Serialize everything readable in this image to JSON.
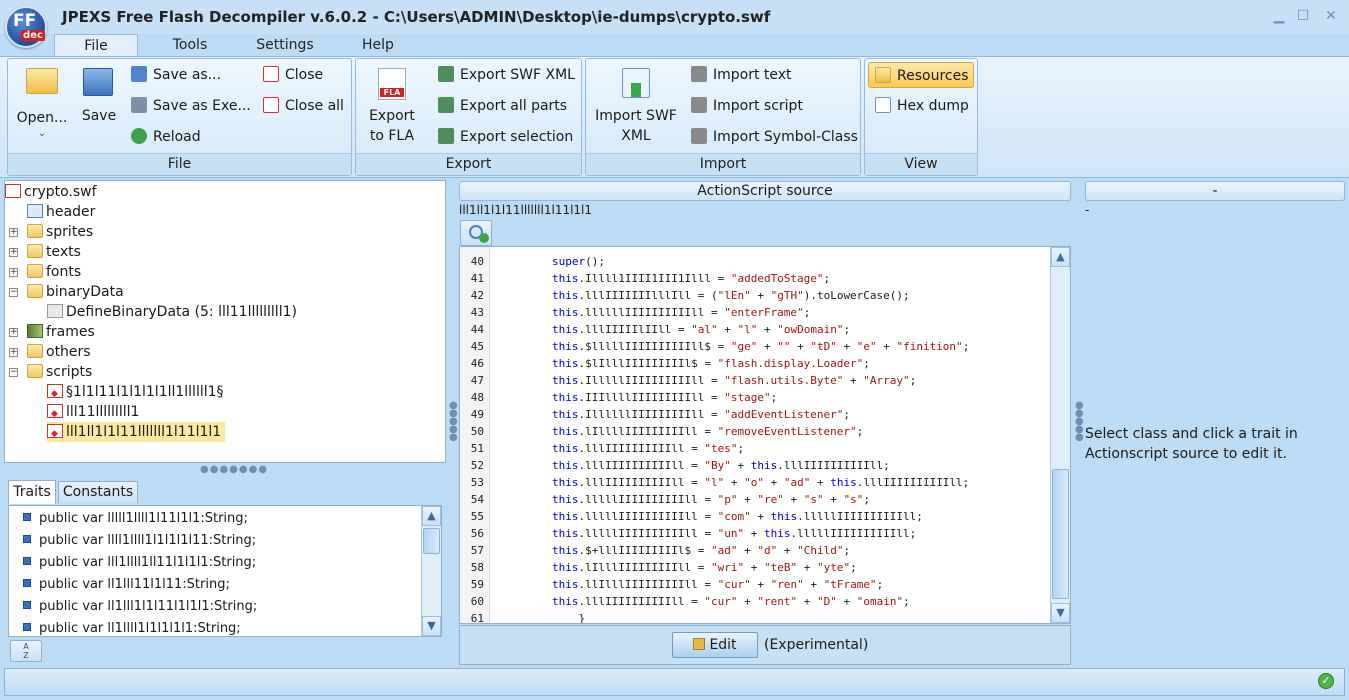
{
  "window": {
    "title": "JPEXS Free Flash Decompiler v.6.0.2 - C:\\Users\\ADMIN\\Desktop\\ie-dumps\\crypto.swf",
    "logo_text": "FF",
    "logo_sub": "dec"
  },
  "ribbon_tabs": [
    "File",
    "Tools",
    "Settings",
    "Help"
  ],
  "ribbon": {
    "file_group": {
      "label": "File",
      "open": "Open...",
      "save": "Save",
      "save_as": "Save as...",
      "save_as_exe": "Save as Exe...",
      "reload": "Reload",
      "close": "Close",
      "close_all": "Close all"
    },
    "export_group": {
      "label": "Export",
      "export_fla_1": "Export",
      "export_fla_2": "to FLA",
      "fla_badge": "FLA",
      "export_swf_xml": "Export SWF XML",
      "export_all_parts": "Export all parts",
      "export_selection": "Export selection"
    },
    "import_group": {
      "label": "Import",
      "import_swf_xml_1": "Import SWF",
      "import_swf_xml_2": "XML",
      "import_text": "Import text",
      "import_script": "Import script",
      "import_symbol_class": "Import Symbol-Class"
    },
    "view_group": {
      "label": "View",
      "resources": "Resources",
      "hex_dump": "Hex dump"
    }
  },
  "tree": {
    "root": "crypto.swf",
    "items": [
      {
        "label": "header",
        "depth": 1
      },
      {
        "label": "sprites",
        "depth": 1
      },
      {
        "label": "texts",
        "depth": 1
      },
      {
        "label": "fonts",
        "depth": 1
      },
      {
        "label": "binaryData",
        "depth": 1
      },
      {
        "label": "DefineBinaryData (5: lll11lllllllll1)",
        "depth": 2
      },
      {
        "label": "frames",
        "depth": 1
      },
      {
        "label": "others",
        "depth": 1
      },
      {
        "label": "scripts",
        "depth": 1
      },
      {
        "label": "§1l1l11l1l1l1l1ll1llllll1§",
        "depth": 2
      },
      {
        "label": "lll11lllllllll1",
        "depth": 2
      },
      {
        "label": "lll1ll1l1l11lllllll1l11l1l1",
        "depth": 2
      }
    ]
  },
  "bottom_tabs": [
    "Traits",
    "Constants"
  ],
  "traits": [
    "public var lllll1llll1l11l1l1:String;",
    "public var llll1llll1l1l1l1l11:String;",
    "public var lll1llll1ll11l1l1l1:String;",
    "public var ll1lll11l1l11:String;",
    "public var ll1lll1l1l11l1l1l1:String;",
    "public var ll1llll1l1l1l1l1:String;"
  ],
  "sort_button": "A\nZ",
  "action_header": "ActionScript source",
  "script_path": "lll1ll1l1l11lllllll1l11l1l1",
  "code_lines": [
    {
      "n": "40",
      "parts": [
        [
          "k",
          "super"
        ],
        [
          "p",
          "();"
        ]
      ]
    },
    {
      "n": "41",
      "parts": [
        [
          "k",
          "this"
        ],
        [
          "p",
          ".Illll1IIII1III1Illl = "
        ],
        [
          "s",
          "\"addedToStage\""
        ],
        [
          "p",
          ";"
        ]
      ]
    },
    {
      "n": "42",
      "parts": [
        [
          "k",
          "this"
        ],
        [
          "p",
          ".lllIIIIIIIlllIll = ("
        ],
        [
          "s",
          "\"lEn\""
        ],
        [
          "p",
          " + "
        ],
        [
          "s",
          "\"gTH\""
        ],
        [
          "p",
          ").toLowerCase();"
        ]
      ]
    },
    {
      "n": "43",
      "parts": [
        [
          "k",
          "this"
        ],
        [
          "p",
          ".llllllIIIIIIIIIIll = "
        ],
        [
          "s",
          "\"enterFrame\""
        ],
        [
          "p",
          ";"
        ]
      ]
    },
    {
      "n": "44",
      "parts": [
        [
          "k",
          "this"
        ],
        [
          "p",
          ".lllIIIIIlIIll = "
        ],
        [
          "s",
          "\"al\""
        ],
        [
          "p",
          " + "
        ],
        [
          "s",
          "\"l\""
        ],
        [
          "p",
          " + "
        ],
        [
          "s",
          "\"owDomain\""
        ],
        [
          "p",
          ";"
        ]
      ]
    },
    {
      "n": "45",
      "parts": [
        [
          "k",
          "this"
        ],
        [
          "p",
          ".$lllllIIIIIIIIIIll$ = "
        ],
        [
          "s",
          "\"ge\""
        ],
        [
          "p",
          " + "
        ],
        [
          "s",
          "\"\""
        ],
        [
          "p",
          " + "
        ],
        [
          "s",
          "\"tD\""
        ],
        [
          "p",
          " + "
        ],
        [
          "s",
          "\"e\""
        ],
        [
          "p",
          " + "
        ],
        [
          "s",
          "\"finition\""
        ],
        [
          "p",
          ";"
        ]
      ]
    },
    {
      "n": "46",
      "parts": [
        [
          "k",
          "this"
        ],
        [
          "p",
          ".$lIlllIIIIIIIIIl$ = "
        ],
        [
          "s",
          "\"flash.display.Loader\""
        ],
        [
          "p",
          ";"
        ]
      ]
    },
    {
      "n": "47",
      "parts": [
        [
          "k",
          "this"
        ],
        [
          "p",
          ".IlllllIIIIIIIIIIll = "
        ],
        [
          "s",
          "\"flash.utils.Byte\""
        ],
        [
          "p",
          " + "
        ],
        [
          "s",
          "\"Array\""
        ],
        [
          "p",
          ";"
        ]
      ]
    },
    {
      "n": "48",
      "parts": [
        [
          "k",
          "this"
        ],
        [
          "p",
          ".IIIllllIIIIIIIIIll = "
        ],
        [
          "s",
          "\"stage\""
        ],
        [
          "p",
          ";"
        ]
      ]
    },
    {
      "n": "49",
      "parts": [
        [
          "k",
          "this"
        ],
        [
          "p",
          ".IllllllIIIIIIIIIll = "
        ],
        [
          "s",
          "\"addEventListener\""
        ],
        [
          "p",
          ";"
        ]
      ]
    },
    {
      "n": "50",
      "parts": [
        [
          "k",
          "this"
        ],
        [
          "p",
          ".lIllllIIIIIIIIIll = "
        ],
        [
          "s",
          "\"removeEventListener\""
        ],
        [
          "p",
          ";"
        ]
      ]
    },
    {
      "n": "51",
      "parts": [
        [
          "k",
          "this"
        ],
        [
          "p",
          ".lllIIIIIIIIIIll = "
        ],
        [
          "s",
          "\"tes\""
        ],
        [
          "p",
          ";"
        ]
      ]
    },
    {
      "n": "52",
      "parts": [
        [
          "k",
          "this"
        ],
        [
          "p",
          ".lllIIIIIIIIIIll = "
        ],
        [
          "s",
          "\"By\""
        ],
        [
          "p",
          " + "
        ],
        [
          "k",
          "this"
        ],
        [
          "p",
          ".lllIIIIIIIIIIll;"
        ]
      ]
    },
    {
      "n": "53",
      "parts": [
        [
          "k",
          "this"
        ],
        [
          "p",
          ".lllIIIIIIIIIIll = "
        ],
        [
          "s",
          "\"l\""
        ],
        [
          "p",
          " + "
        ],
        [
          "s",
          "\"o\""
        ],
        [
          "p",
          " + "
        ],
        [
          "s",
          "\"ad\""
        ],
        [
          "p",
          " + "
        ],
        [
          "k",
          "this"
        ],
        [
          "p",
          ".lllIIIIIIIIIIll;"
        ]
      ]
    },
    {
      "n": "54",
      "parts": [
        [
          "k",
          "this"
        ],
        [
          "p",
          ".lllllIIIIIIIIIIll = "
        ],
        [
          "s",
          "\"p\""
        ],
        [
          "p",
          " + "
        ],
        [
          "s",
          "\"re\""
        ],
        [
          "p",
          " + "
        ],
        [
          "s",
          "\"s\""
        ],
        [
          "p",
          " + "
        ],
        [
          "s",
          "\"s\""
        ],
        [
          "p",
          ";"
        ]
      ]
    },
    {
      "n": "55",
      "parts": [
        [
          "k",
          "this"
        ],
        [
          "p",
          ".lllllIIIIIIIIIIll = "
        ],
        [
          "s",
          "\"com\""
        ],
        [
          "p",
          " + "
        ],
        [
          "k",
          "this"
        ],
        [
          "p",
          ".lllllIIIIIIIIIIll;"
        ]
      ]
    },
    {
      "n": "56",
      "parts": [
        [
          "k",
          "this"
        ],
        [
          "p",
          ".lllllIIIIIIIIIIll = "
        ],
        [
          "s",
          "\"un\""
        ],
        [
          "p",
          " + "
        ],
        [
          "k",
          "this"
        ],
        [
          "p",
          ".lllllIIIIIIIIIIll;"
        ]
      ]
    },
    {
      "n": "57",
      "parts": [
        [
          "k",
          "this"
        ],
        [
          "p",
          ".$+lllIIIIIIIIIl$ = "
        ],
        [
          "s",
          "\"ad\""
        ],
        [
          "p",
          " + "
        ],
        [
          "s",
          "\"d\""
        ],
        [
          "p",
          " + "
        ],
        [
          "s",
          "\"Child\""
        ],
        [
          "p",
          ";"
        ]
      ]
    },
    {
      "n": "58",
      "parts": [
        [
          "k",
          "this"
        ],
        [
          "p",
          ".lIlllIIIIIIIIIll = "
        ],
        [
          "s",
          "\"wri\""
        ],
        [
          "p",
          " + "
        ],
        [
          "s",
          "\"teB\""
        ],
        [
          "p",
          " + "
        ],
        [
          "s",
          "\"yte\""
        ],
        [
          "p",
          ";"
        ]
      ]
    },
    {
      "n": "59",
      "parts": [
        [
          "k",
          "this"
        ],
        [
          "p",
          ".llIlllIIIIIIIIIll = "
        ],
        [
          "s",
          "\"cur\""
        ],
        [
          "p",
          " + "
        ],
        [
          "s",
          "\"ren\""
        ],
        [
          "p",
          " + "
        ],
        [
          "s",
          "\"tFrame\""
        ],
        [
          "p",
          ";"
        ]
      ]
    },
    {
      "n": "60",
      "parts": [
        [
          "k",
          "this"
        ],
        [
          "p",
          ".lllIIIIIIIIIIll = "
        ],
        [
          "s",
          "\"cur\""
        ],
        [
          "p",
          " + "
        ],
        [
          "s",
          "\"rent\""
        ],
        [
          "p",
          " + "
        ],
        [
          "s",
          "\"D\""
        ],
        [
          "p",
          " + "
        ],
        [
          "s",
          "\"omain\""
        ],
        [
          "p",
          ";"
        ]
      ]
    },
    {
      "n": "61",
      "parts": [
        [
          "p",
          "    }"
        ]
      ]
    }
  ],
  "edit_button": "Edit",
  "experimental": "(Experimental)",
  "right_panel": {
    "header": "-",
    "dash": "-",
    "hint": "Select class and click a trait in Actionscript source to edit it."
  },
  "colors": {
    "accent": "#bcdcf6",
    "keyword": "#0000d0",
    "string": "#a31515",
    "selection": "#fbe9a0"
  }
}
